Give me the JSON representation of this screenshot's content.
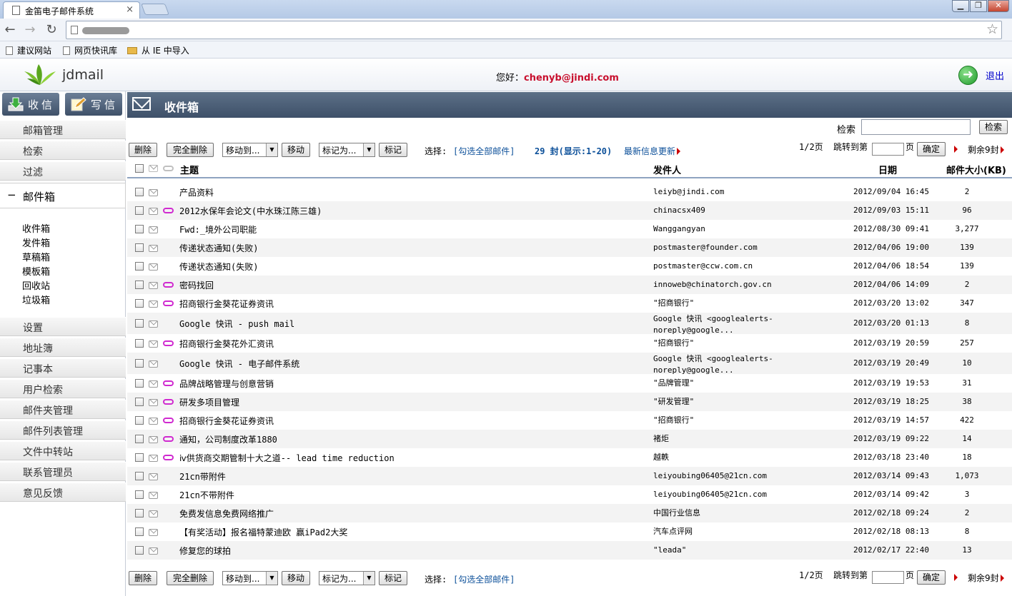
{
  "browser": {
    "tab_title": "金笛电子邮件系统",
    "tab_close": "×",
    "bookmarks": [
      "建议网站",
      "网页快讯库",
      "从 IE 中导入"
    ]
  },
  "header": {
    "logo_text": "jdmail",
    "greeting": "您好：",
    "user_email": "chenyb@jindi.com",
    "logout": "退出"
  },
  "sidebar": {
    "receive_button": "收信",
    "write_button": "写信",
    "menu_top": [
      "邮箱管理",
      "检索",
      "过滤"
    ],
    "mailbox_label": "邮件箱",
    "mailbox_folders": [
      "收件箱",
      "发件箱",
      "草稿箱",
      "模板箱",
      "回收站",
      "垃圾箱"
    ],
    "menu_bottom": [
      "设置",
      "地址簿",
      "记事本",
      "用户检索",
      "邮件夹管理",
      "邮件列表管理",
      "文件中转站",
      "联系管理员",
      "意见反馈"
    ]
  },
  "main": {
    "title": "收件箱",
    "search_label": "检索",
    "search_button": "检索",
    "toolbar": {
      "delete": "删除",
      "delete_all": "完全删除",
      "move_to": "移动到...",
      "move": "移动",
      "mark_as": "标记为...",
      "mark": "标记",
      "select_label": "选择:",
      "select_all": "[勾选全部邮件]",
      "count": "29 封(显示:1-20)",
      "refresh": "最新信息更新",
      "page": "1/2页",
      "jump_to": "跳转到第",
      "page_unit": "页",
      "confirm": "确定",
      "remaining": "剩余9封"
    },
    "columns": {
      "subject": "主题",
      "from": "发件人",
      "date": "日期",
      "size": "邮件大小(KB)"
    },
    "emails": [
      {
        "subject": "产品资料",
        "from": "leiyb@jindi.com",
        "date": "2012/09/04 16:45",
        "size": "2",
        "attach": false
      },
      {
        "subject": "2012水保年会论文(中水珠江陈三雄)",
        "from": "chinacsx409",
        "date": "2012/09/03 15:11",
        "size": "96",
        "attach": true
      },
      {
        "subject": "Fwd:_境外公司职能",
        "from": "Wanggangyan",
        "date": "2012/08/30 09:41",
        "size": "3,277",
        "attach": false
      },
      {
        "subject": "传递状态通知(失败)",
        "from": "postmaster@founder.com",
        "date": "2012/04/06 19:00",
        "size": "139",
        "attach": false
      },
      {
        "subject": "传递状态通知(失败)",
        "from": "postmaster@ccw.com.cn",
        "date": "2012/04/06 18:54",
        "size": "139",
        "attach": false
      },
      {
        "subject": "密码找回",
        "from": "innoweb@chinatorch.gov.cn",
        "date": "2012/04/06 14:09",
        "size": "2",
        "attach": true
      },
      {
        "subject": "招商银行金葵花证券资讯",
        "from": "\"招商银行\"",
        "date": "2012/03/20 13:02",
        "size": "347",
        "attach": true
      },
      {
        "subject": "Google 快讯 - push mail",
        "from": "Google 快讯 <googlealerts-noreply@google...",
        "date": "2012/03/20 01:13",
        "size": "8",
        "attach": false,
        "tall": true
      },
      {
        "subject": "招商银行金葵花外汇资讯",
        "from": "\"招商银行\"",
        "date": "2012/03/19 20:59",
        "size": "257",
        "attach": true
      },
      {
        "subject": "Google 快讯 - 电子邮件系统",
        "from": "Google 快讯 <googlealerts-noreply@google...",
        "date": "2012/03/19 20:49",
        "size": "10",
        "attach": false,
        "tall": true
      },
      {
        "subject": "品牌战略管理与创意营销",
        "from": "\"品牌管理\"",
        "date": "2012/03/19 19:53",
        "size": "31",
        "attach": true
      },
      {
        "subject": "研发多项目管理",
        "from": "\"研发管理\"",
        "date": "2012/03/19 18:25",
        "size": "38",
        "attach": true
      },
      {
        "subject": "招商银行金葵花证券资讯",
        "from": "\"招商银行\"",
        "date": "2012/03/19 14:57",
        "size": "422",
        "attach": true
      },
      {
        "subject": "通知，公司制度改革1880",
        "from": "褚炬",
        "date": "2012/03/19 09:22",
        "size": "14",
        "attach": true
      },
      {
        "subject": "ⅳ供货商交期管制十大之道-- lead time reduction",
        "from": "越軼",
        "date": "2012/03/18 23:40",
        "size": "18",
        "attach": true
      },
      {
        "subject": "21cn带附件",
        "from": "leiyoubing06405@21cn.com",
        "date": "2012/03/14 09:43",
        "size": "1,073",
        "attach": false
      },
      {
        "subject": "21cn不带附件",
        "from": "leiyoubing06405@21cn.com",
        "date": "2012/03/14 09:42",
        "size": "3",
        "attach": false
      },
      {
        "subject": "免费发信息免费网络推广",
        "from": "中国行业信息",
        "date": "2012/02/18 09:24",
        "size": "2",
        "attach": false
      },
      {
        "subject": "【有奖活动】报名福特蒙迪欧 赢iPad2大奖",
        "from": "汽车点评网",
        "date": "2012/02/18 08:13",
        "size": "8",
        "attach": false
      },
      {
        "subject": "修复您的球拍",
        "from": "\"leada\"",
        "date": "2012/02/17 22:40",
        "size": "13",
        "attach": false
      }
    ]
  },
  "colors": {
    "title_bar": "#4a5d77",
    "email_red": "#c8102e",
    "attach_clip": "#d02ad0",
    "link": "#0b4f99"
  }
}
